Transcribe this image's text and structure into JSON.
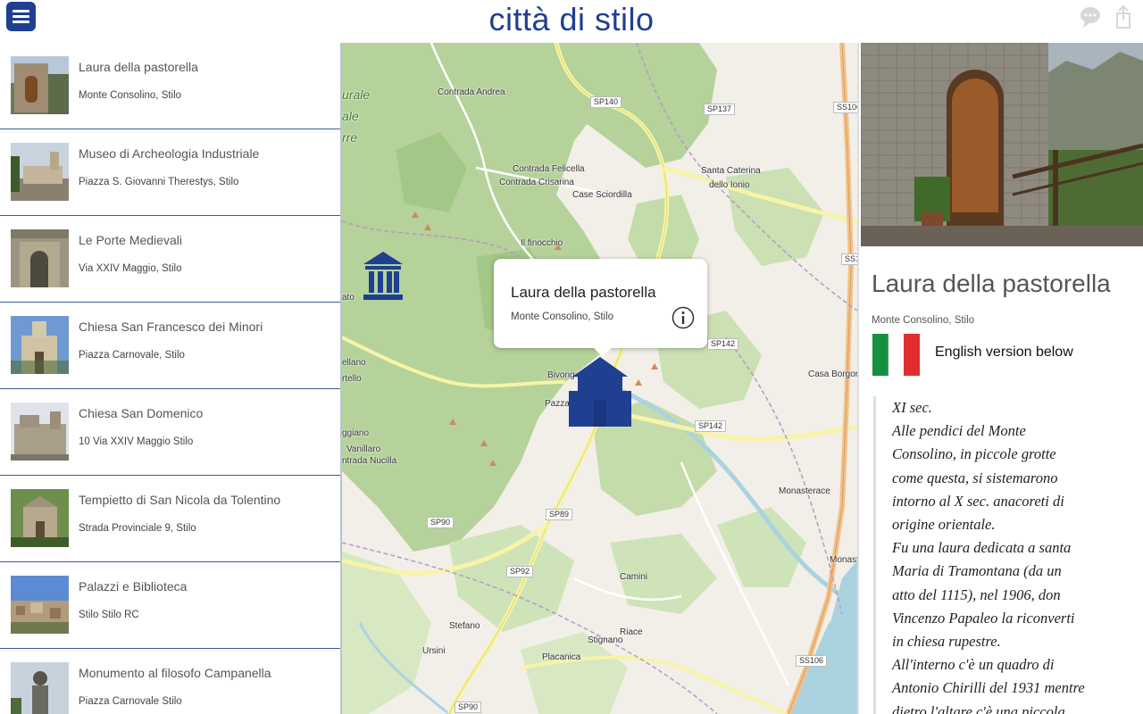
{
  "header": {
    "title": "città di stilo",
    "menu_icon": "hamburger-menu-icon",
    "chat_icon": "chat-bubble-icon",
    "share_icon": "share-icon",
    "brand_color": "#1f3f91"
  },
  "list": {
    "items": [
      {
        "title": "Laura della pastorella",
        "subtitle": "Monte Consolino, Stilo"
      },
      {
        "title": "Museo di Archeologia Industriale",
        "subtitle": "Piazza S. Giovanni Therestys, Stilo"
      },
      {
        "title": "Le Porte Medievali",
        "subtitle": "Via XXIV Maggio, Stilo"
      },
      {
        "title": "Chiesa San Francesco dei Minori",
        "subtitle": "Piazza Carnovale, Stilo"
      },
      {
        "title": "Chiesa San Domenico",
        "subtitle": "10 Via XXIV Maggio Stilo"
      },
      {
        "title": "Tempietto di San Nicola da Tolentino",
        "subtitle": "Strada Provinciale 9, Stilo"
      },
      {
        "title": "Palazzi e Biblioteca",
        "subtitle": "Stilo Stilo RC"
      },
      {
        "title": "Monumento al filosofo Campanella",
        "subtitle": "Piazza Carnovale Stilo"
      }
    ]
  },
  "map": {
    "labels": {
      "contrada_andrea": "Contrada Andrea",
      "contrada_felicella": "Contrada Felicella",
      "contrada_crisarina": "Contrada Crisarina",
      "case_sciordilla": "Case Sciordilla",
      "santa_caterina_1": "Santa Caterina",
      "santa_caterina_2": "dello Ionio",
      "il_finocchio": "Il finocchio",
      "bivongi": "Bivong",
      "pazzano": "Pazzan",
      "casa_borgo": "Casa Borgor",
      "monasterace": "Monasterace",
      "monast": "Monast",
      "camini": "Camini",
      "stefano": "Stefano",
      "ursini": "Ursini",
      "stignano": "Stignano",
      "riace": "Riace",
      "placanica": "Placanica",
      "vanillaro": "Vanillaro",
      "nucilla": "ntrada Nucilla",
      "ggiano": "ggiano",
      "ellano": "ellano",
      "rtello": "rtello",
      "ato": "ato",
      "park_1": "urale",
      "park_2": "ale",
      "park_3": "rre"
    },
    "roads": {
      "sp140": "SP140",
      "sp137": "SP137",
      "ss106_top": "SS106",
      "ss1": "SS1",
      "sp142_a": "SP142",
      "sp142_b": "SP142",
      "sp89": "SP89",
      "sp90_a": "SP90",
      "sp90_b": "SP90",
      "sp92": "SP92",
      "ss106_bottom": "SS106"
    },
    "museum_marker_icon": "museum-marker-icon",
    "place_marker_icon": "church-marker-icon",
    "popup": {
      "title": "Laura della pastorella",
      "subtitle": "Monte Consolino, Stilo",
      "info_icon": "info-icon"
    }
  },
  "detail": {
    "title": "Laura della pastorella",
    "subtitle": "Monte Consolino, Stilo",
    "flag_icon": "italian-flag-icon",
    "language_note": "English version below",
    "description_lines": [
      "XI sec.",
      "Alle pendici del Monte",
      "Consolino, in piccole grotte",
      "come questa, si sistemarono",
      "intorno al X sec. anacoreti di",
      "origine orientale.",
      "Fu una laura dedicata a santa",
      "Maria di Tramontana (da un",
      "atto del 1115), nel 1906, don",
      "Vincenzo Papaleo la riconverti",
      "in chiesa rupestre.",
      "All'interno c'è un quadro di",
      "Antonio Chirilli del 1931 mentre",
      "dietro l'altare c'è una piccola"
    ]
  }
}
